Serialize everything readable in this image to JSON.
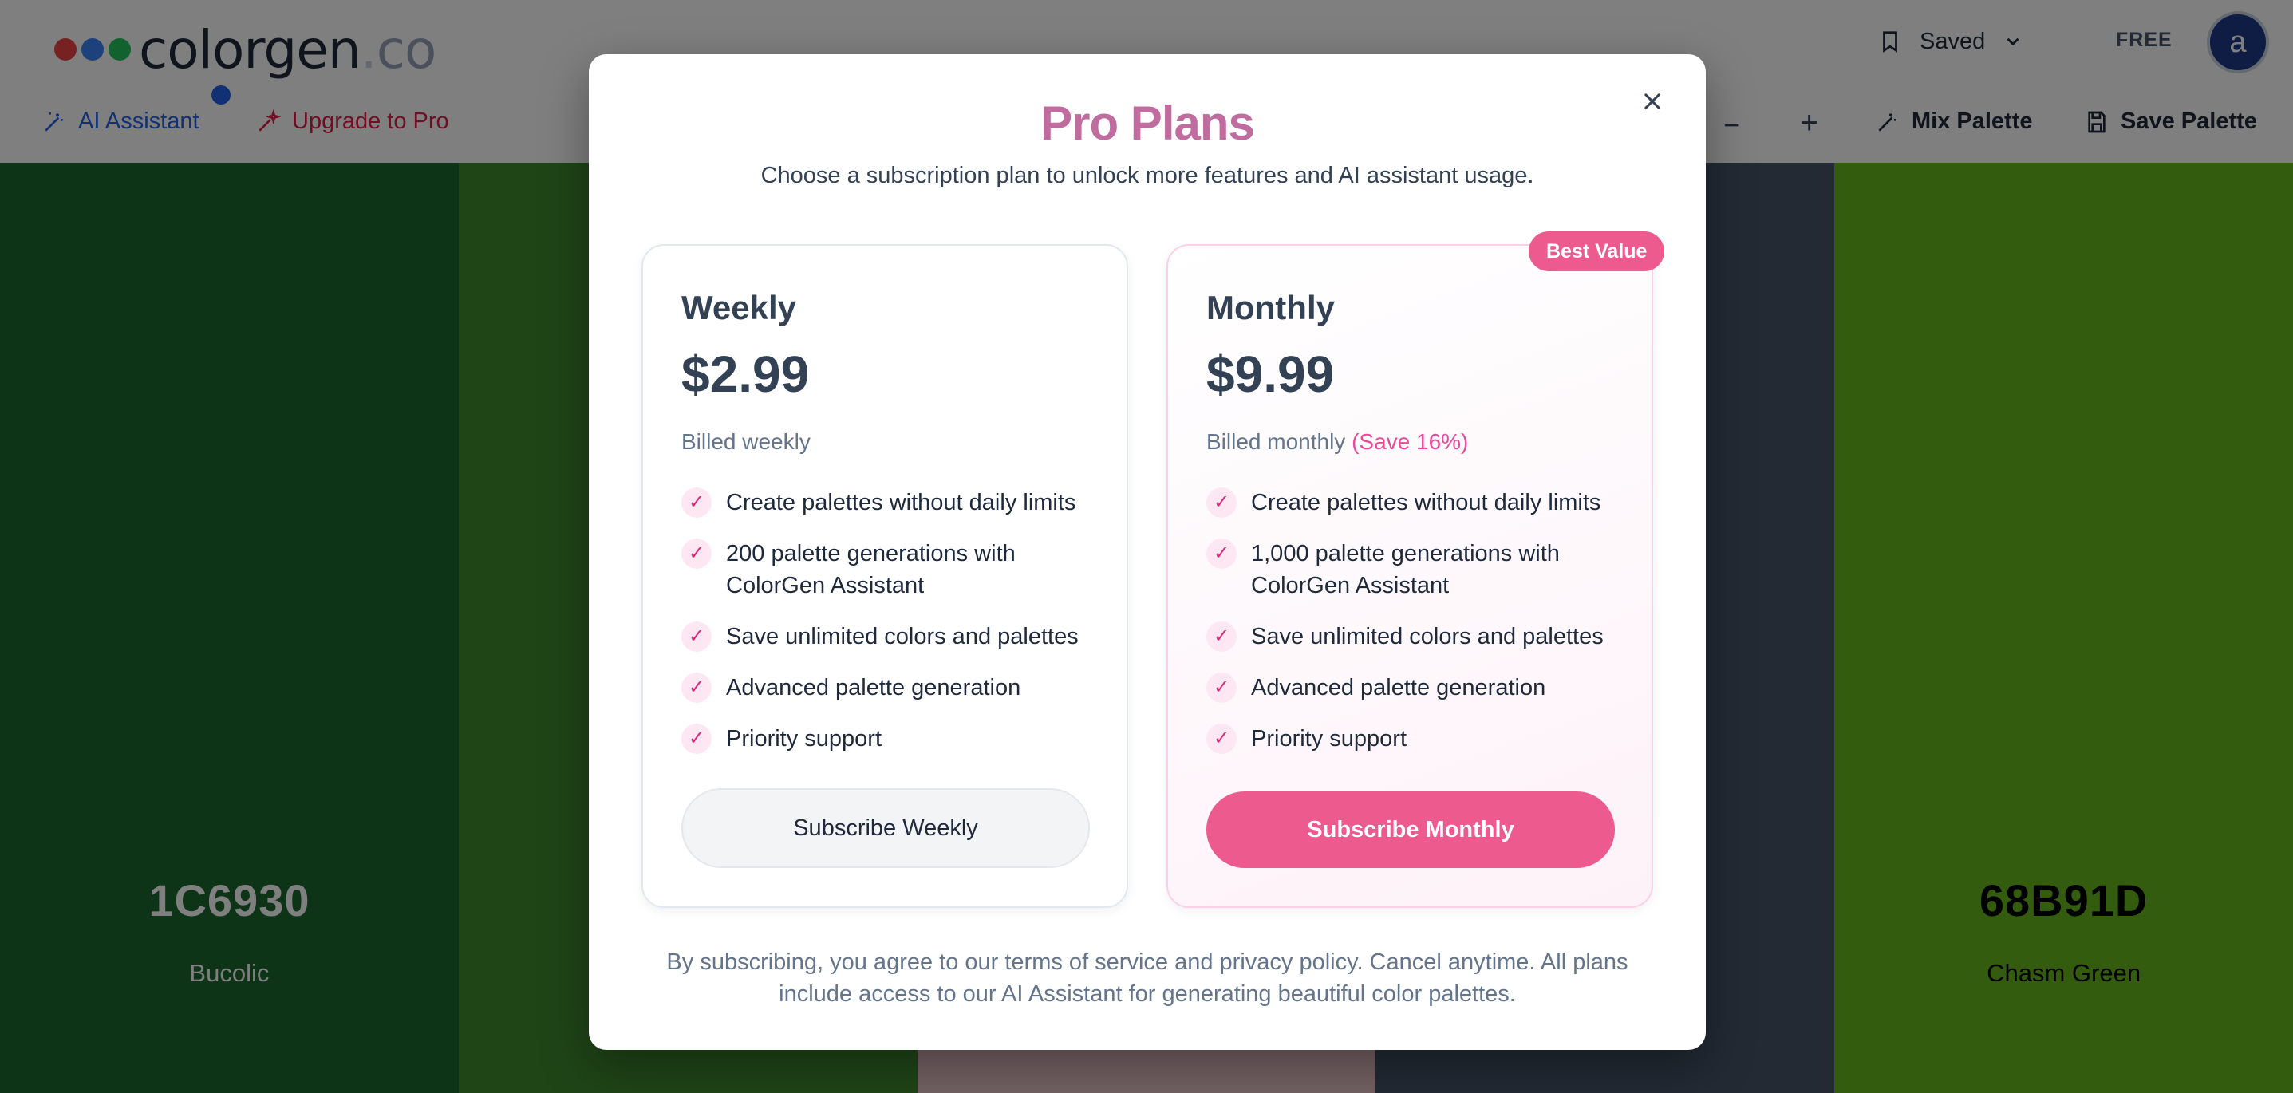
{
  "header": {
    "logo": {
      "text": "colorgen",
      "dot": ".",
      "tld": "co",
      "dot_colors": [
        "#ef4444",
        "#3b82f6",
        "#22c55e"
      ]
    },
    "saved_label": "Saved",
    "plan_badge": "FREE",
    "avatar_letter": "a",
    "ai_assistant_label": "AI Assistant",
    "upgrade_label": "Upgrade to Pro",
    "mix_palette_label": "Mix Palette",
    "save_palette_label": "Save Palette"
  },
  "palette": [
    {
      "color": "#1C6930",
      "hex": "1C6930",
      "name": "Bucolic",
      "text_color": "#ffffff"
    },
    {
      "color": "#3f8a2e",
      "hex": "",
      "name": "",
      "text_color": "#ffffff"
    },
    {
      "color": "#e8c4c8",
      "hex": "",
      "name": "",
      "text_color": "#1e293b"
    },
    {
      "color": "#475569",
      "hex": "",
      "name": "",
      "text_color": "#ffffff"
    },
    {
      "color": "#68B91D",
      "hex": "68B91D",
      "name": "Chasm Green",
      "text_color": "#000000"
    }
  ],
  "modal": {
    "title": "Pro Plans",
    "subtitle": "Choose a subscription plan to unlock more features and AI assistant usage.",
    "best_value_badge": "Best Value",
    "plans": {
      "weekly": {
        "name": "Weekly",
        "price": "$2.99",
        "billing": "Billed weekly",
        "features": [
          "Create palettes without daily limits",
          "200 palette generations with ColorGen Assistant",
          "Save unlimited colors and palettes",
          "Advanced palette generation",
          "Priority support"
        ],
        "button": "Subscribe Weekly"
      },
      "monthly": {
        "name": "Monthly",
        "price": "$9.99",
        "billing": "Billed monthly",
        "savings": "(Save 16%)",
        "features": [
          "Create palettes without daily limits",
          "1,000 palette generations with ColorGen Assistant",
          "Save unlimited colors and palettes",
          "Advanced palette generation",
          "Priority support"
        ],
        "button": "Subscribe Monthly"
      }
    },
    "disclaimer": "By subscribing, you agree to our terms of service and privacy policy. Cancel anytime. All plans include access to our AI Assistant for generating beautiful color palettes."
  },
  "colors": {
    "accent_pink": "#ec5a8e",
    "title_pink": "#c06c9f",
    "ai_blue": "#2563eb",
    "upgrade_red": "#e11d48"
  }
}
